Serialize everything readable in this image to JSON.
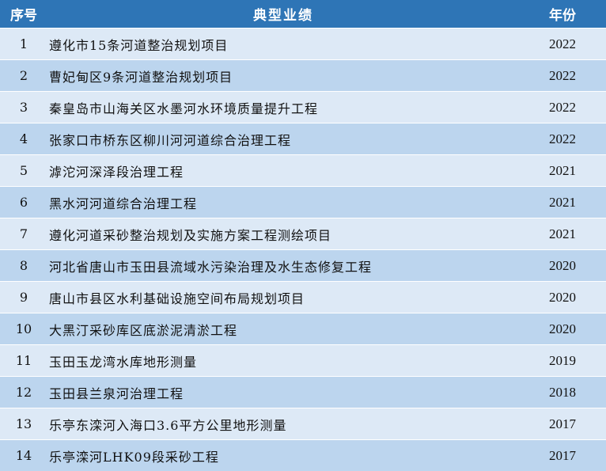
{
  "header": {
    "no": "序号",
    "name": "典型业绩",
    "year": "年份"
  },
  "rows": [
    {
      "no": "1",
      "name": "遵化市15条河道整治规划项目",
      "year": "2022"
    },
    {
      "no": "2",
      "name": "曹妃甸区9条河道整治规划项目",
      "year": "2022"
    },
    {
      "no": "3",
      "name": "秦皇岛市山海关区水墨河水环境质量提升工程",
      "year": "2022"
    },
    {
      "no": "4",
      "name": "张家口市桥东区柳川河河道综合治理工程",
      "year": "2022"
    },
    {
      "no": "5",
      "name": "滹沱河深泽段治理工程",
      "year": "2021"
    },
    {
      "no": "6",
      "name": "黑水河河道综合治理工程",
      "year": "2021"
    },
    {
      "no": "7",
      "name": "遵化河道采砂整治规划及实施方案工程测绘项目",
      "year": "2021"
    },
    {
      "no": "8",
      "name": "河北省唐山市玉田县流域水污染治理及水生态修复工程",
      "year": "2020"
    },
    {
      "no": "9",
      "name": "唐山市县区水利基础设施空间布局规划项目",
      "year": "2020"
    },
    {
      "no": "10",
      "name": "大黑汀采砂库区底淤泥清淤工程",
      "year": "2020"
    },
    {
      "no": "11",
      "name": "玉田玉龙湾水库地形测量",
      "year": "2019"
    },
    {
      "no": "12",
      "name": "玉田县兰泉河治理工程",
      "year": "2018"
    },
    {
      "no": "13",
      "name": "乐亭东滦河入海口3.6平方公里地形测量",
      "year": "2017"
    },
    {
      "no": "14",
      "name": "乐亭滦河LHK09段采砂工程",
      "year": "2017"
    }
  ]
}
